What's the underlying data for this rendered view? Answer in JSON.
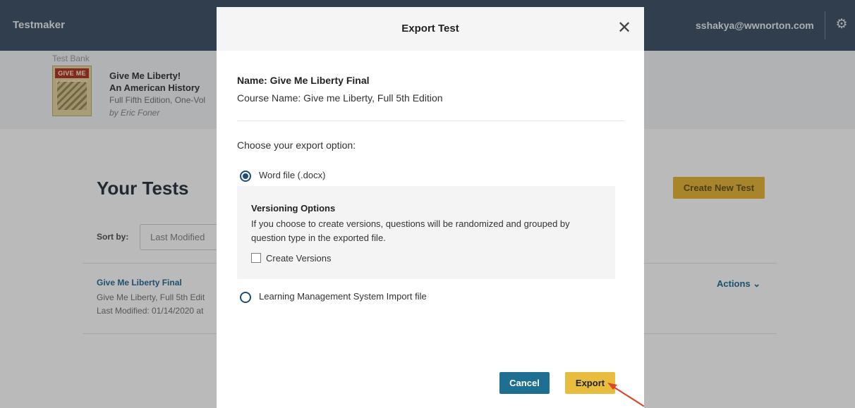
{
  "app": {
    "title": "Testmaker",
    "user_email": "sshakya@wwnorton.com",
    "settings_icon": "gear-icon"
  },
  "test_bank": {
    "label": "Test Bank",
    "cover_text": "GIVE ME LIBERTY!",
    "title_line1": "Give Me Liberty!",
    "title_line2": "An American History",
    "edition": "Full Fifth Edition, One-Vol",
    "author": "by Eric Foner"
  },
  "tests_page": {
    "heading": "Your Tests",
    "create_button": "Create New Test",
    "sort_label": "Sort by:",
    "sort_value": "Last Modified",
    "test": {
      "name": "Give Me Liberty Final",
      "course": "Give Me Liberty, Full 5th Edit",
      "modified": "Last Modified: 01/14/2020 at"
    },
    "actions_label": "Actions ⌄"
  },
  "modal": {
    "title": "Export Test",
    "close_icon": "close-icon",
    "test_name": "Name: Give Me Liberty Final",
    "course_name": "Course Name: Give me Liberty, Full 5th Edition",
    "choose_prompt": "Choose your export option:",
    "options": [
      {
        "label": "Word file (.docx)",
        "selected": true
      },
      {
        "label": "Learning Management System Import file",
        "selected": false
      }
    ],
    "versioning": {
      "title": "Versioning Options",
      "description": "If you choose to create versions, questions will be randomized and grouped by question type in the exported file.",
      "checkbox_label": "Create Versions",
      "checked": false
    },
    "cancel_label": "Cancel",
    "export_label": "Export"
  },
  "colors": {
    "topbar": "#42566a",
    "primary": "#1f6f92",
    "accent": "#e8bd3e",
    "annotation_arrow": "#e0452a"
  }
}
